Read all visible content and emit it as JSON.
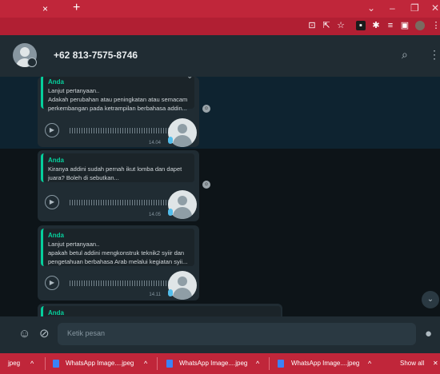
{
  "browser": {
    "tab_close": "×",
    "new_tab": "+",
    "window_controls": {
      "dropdown": "⌄",
      "minimize": "–",
      "restore": "❐",
      "close": "✕"
    },
    "toolbar_icons": [
      "install-icon",
      "share-icon",
      "bookmark-star-icon",
      "extension-icon",
      "puzzle-icon",
      "reading-list-icon",
      "sidebar-icon",
      "profile-icon",
      "menu-icon"
    ]
  },
  "header": {
    "contact": "+62 813-7575-8746",
    "search_icon": "⌕",
    "menu_icon": "⋮"
  },
  "messages": [
    {
      "author": "Anda",
      "lines": [
        "Lanjut pertanyaan..",
        "Adakah perubahan atau peningkatan atau semacam",
        "perkembangan pada ketrampilan berbahasa addin..."
      ],
      "time": "14.04"
    },
    {
      "author": "Anda",
      "lines": [
        "Kiranya addini sudah pernah ikut lomba dan dapet",
        "juara? Boleh di sebutkan..."
      ],
      "time": "14.05"
    },
    {
      "author": "Anda",
      "lines": [
        "Lanjut pertanyaan..",
        "apakah betul addini mengkonstruk teknik2 syiir dan",
        "pengetahuan berbahasa Arab melalui kegiatan syii..."
      ],
      "time": "14.11"
    },
    {
      "author": "Anda"
    }
  ],
  "composer": {
    "placeholder": "Ketik pesan"
  },
  "downloads": {
    "items": [
      {
        "name": "jpeg"
      },
      {
        "name": "WhatsApp Image....jpeg"
      },
      {
        "name": "WhatsApp Image....jpeg"
      },
      {
        "name": "WhatsApp Image....jpeg"
      }
    ],
    "show_all": "Show all",
    "close": "✕"
  },
  "colors": {
    "accent": "#06cf9c",
    "browser": "#c0263a",
    "panel": "#202c33"
  }
}
